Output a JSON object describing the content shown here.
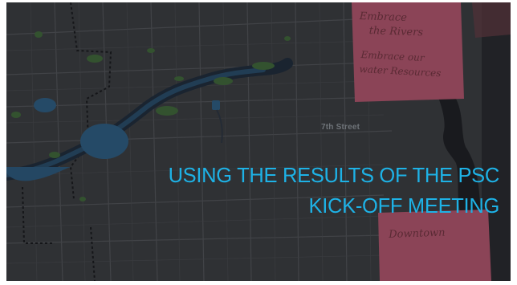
{
  "slide": {
    "title_line_1": "USING THE RESULTS OF THE PSC",
    "title_line_2": "KICK-OFF MEETING",
    "title_color": "#1eb2e6"
  },
  "map": {
    "street_label": "7th Street"
  },
  "sticky_notes": {
    "top_line_1": "Embrace",
    "top_line_2": "the Rivers",
    "top_line_3": "Embrace our",
    "top_line_4": "water Resources",
    "bottom_text": "Downtown",
    "note_color": "#b9566f"
  }
}
